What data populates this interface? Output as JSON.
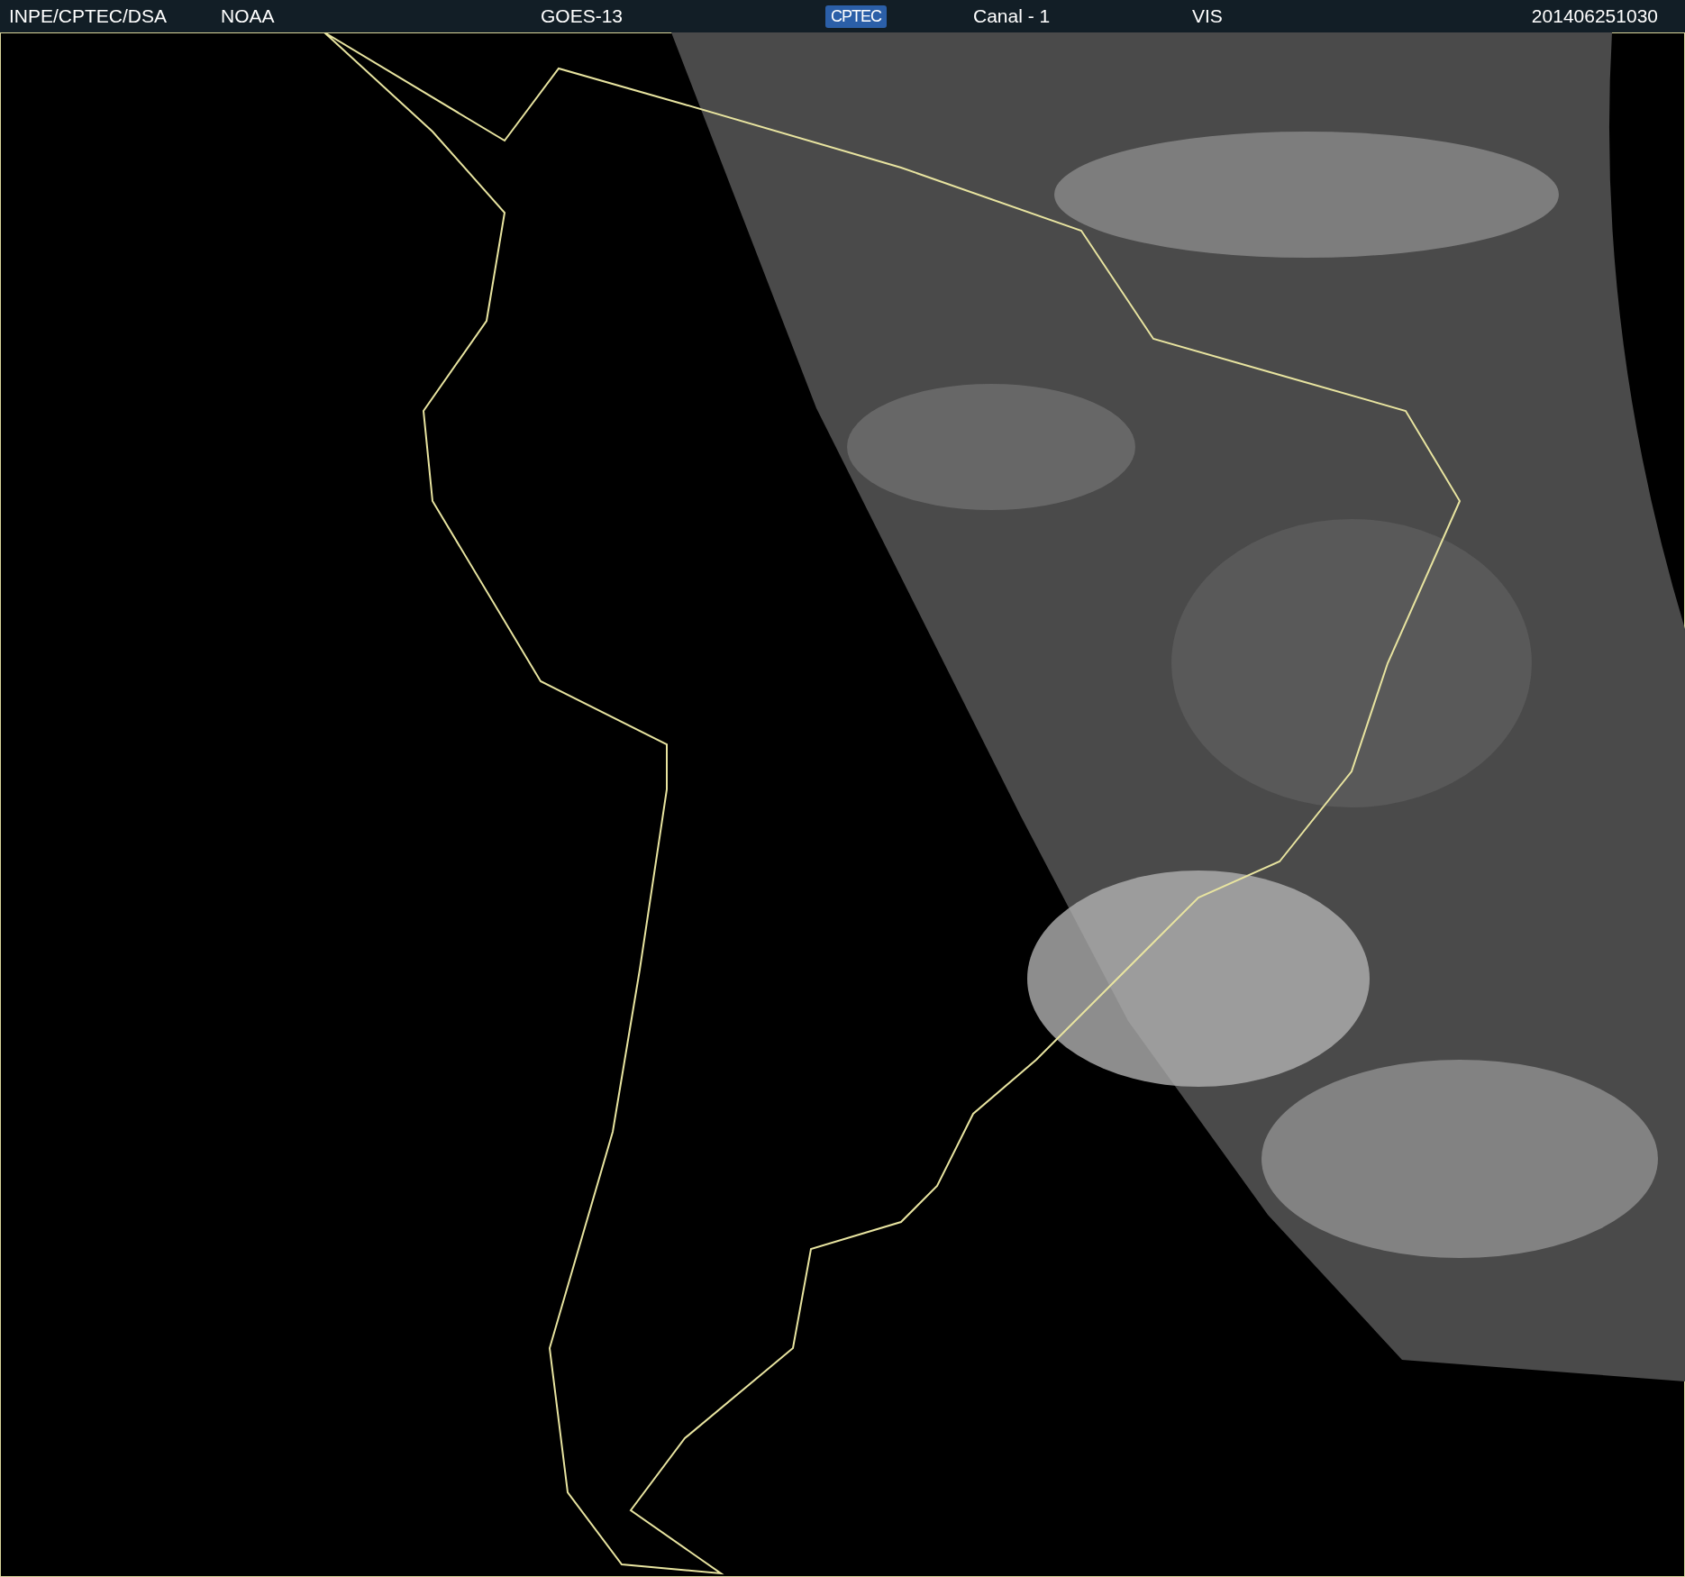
{
  "header": {
    "items": [
      {
        "kind": "text",
        "text": "INPE/CPTEC/DSA"
      },
      {
        "kind": "text",
        "text": "NOAA"
      },
      {
        "kind": "text",
        "text": "GOES-13"
      },
      {
        "kind": "logo",
        "text": "CPTEC"
      },
      {
        "kind": "text",
        "text": "Canal - 1"
      },
      {
        "kind": "text",
        "text": "VIS"
      },
      {
        "kind": "text",
        "text": "201406251030"
      }
    ]
  }
}
